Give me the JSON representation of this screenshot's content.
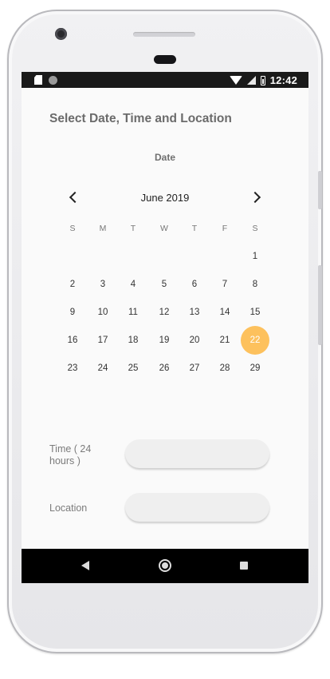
{
  "status_bar": {
    "time": "12:42"
  },
  "page": {
    "title": "Select Date, Time and Location"
  },
  "date_section": {
    "label": "Date"
  },
  "calendar": {
    "month_label": "June 2019",
    "weekdays": [
      "S",
      "M",
      "T",
      "W",
      "T",
      "F",
      "S"
    ],
    "weeks": [
      [
        "",
        "",
        "",
        "",
        "",
        "",
        "1"
      ],
      [
        "2",
        "3",
        "4",
        "5",
        "6",
        "7",
        "8"
      ],
      [
        "9",
        "10",
        "11",
        "12",
        "13",
        "14",
        "15"
      ],
      [
        "16",
        "17",
        "18",
        "19",
        "20",
        "21",
        "22"
      ],
      [
        "23",
        "24",
        "25",
        "26",
        "27",
        "28",
        "29"
      ]
    ],
    "selected_day": "22",
    "selected_color": "#fdc15d"
  },
  "form": {
    "time_label": "Time ( 24 hours )",
    "time_value": "",
    "location_label": "Location",
    "location_value": ""
  },
  "icons": {
    "status_left": [
      "sd-card-icon",
      "circle-icon"
    ],
    "status_right": [
      "wifi-icon",
      "signal-icon",
      "battery-icon"
    ],
    "calendar_nav": [
      "chevron-left-icon",
      "chevron-right-icon"
    ],
    "nav_bar": [
      "back-icon",
      "home-icon",
      "recents-icon"
    ]
  }
}
